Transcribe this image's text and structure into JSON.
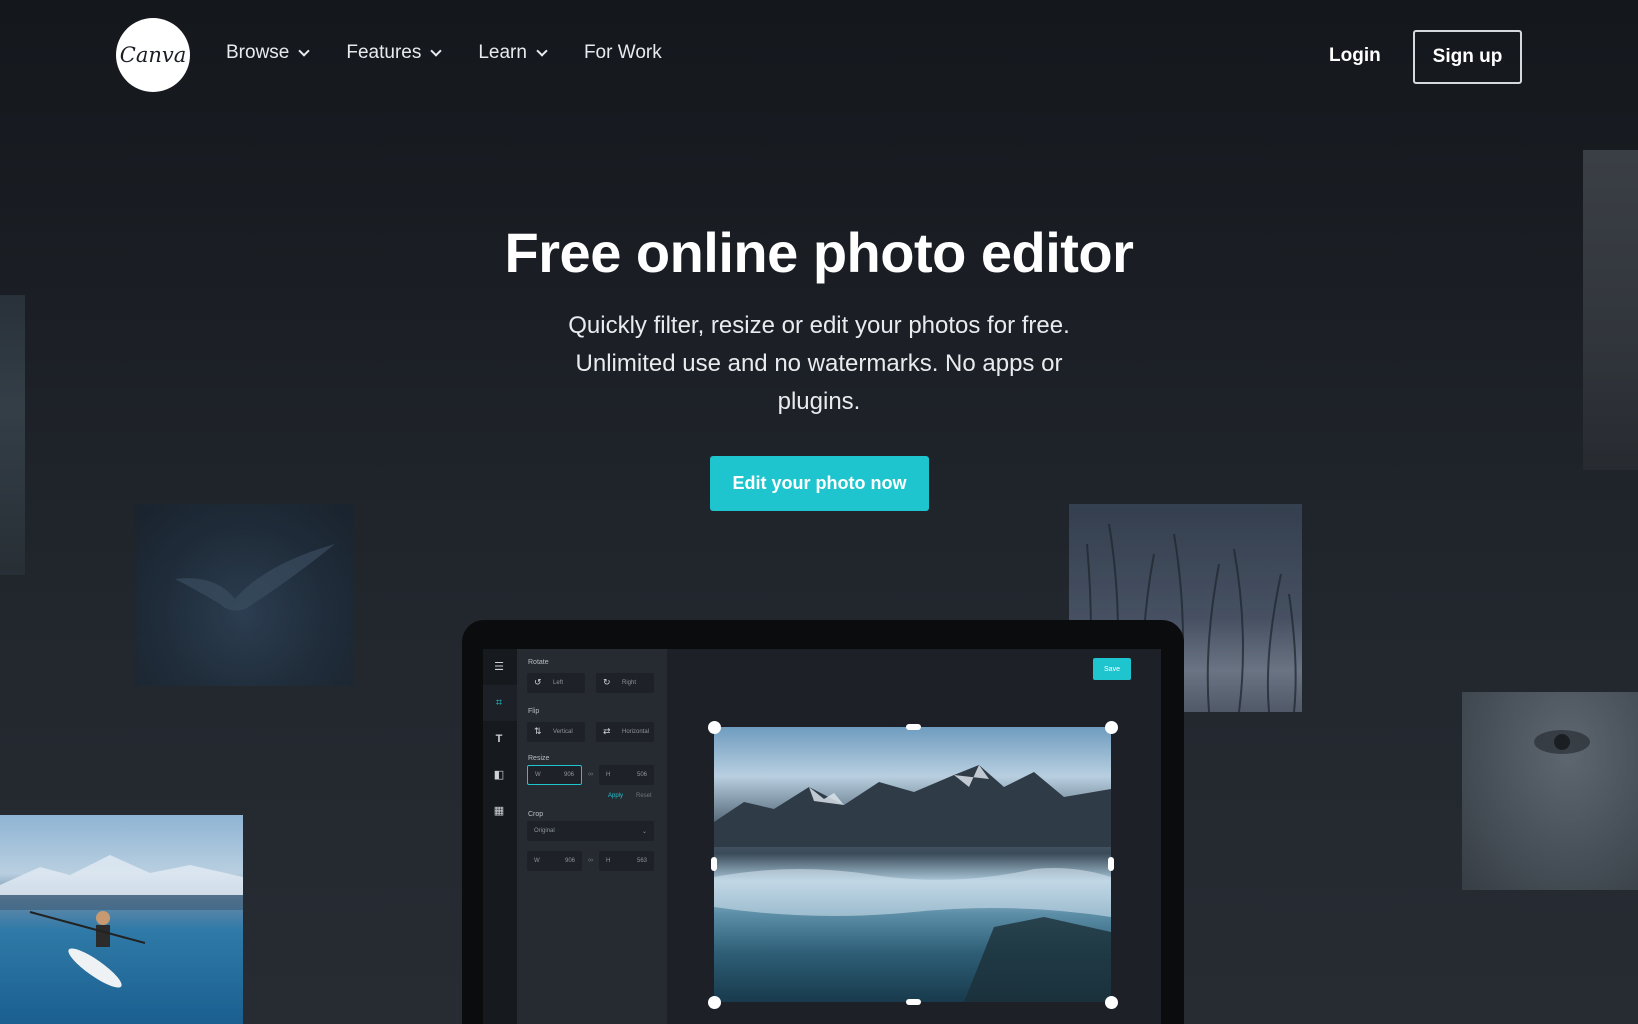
{
  "nav": {
    "logo_text": "Canva",
    "items": [
      {
        "label": "Browse",
        "has_dropdown": true
      },
      {
        "label": "Features",
        "has_dropdown": true
      },
      {
        "label": "Learn",
        "has_dropdown": true
      },
      {
        "label": "For Work",
        "has_dropdown": false
      }
    ],
    "login_label": "Login",
    "signup_label": "Sign up"
  },
  "hero": {
    "title": "Free online photo editor",
    "subtitle_lines": [
      "Quickly filter, resize or edit your photos for free.",
      "Unlimited use and no watermarks. No apps or",
      "plugins."
    ],
    "cta_label": "Edit your photo now"
  },
  "editor": {
    "save_label": "Save",
    "rotate": {
      "label": "Rotate",
      "left": "Left",
      "right": "Right"
    },
    "flip": {
      "label": "Flip",
      "vertical": "Vertical",
      "horizontal": "Horizontal"
    },
    "resize": {
      "label": "Resize",
      "w_prefix": "W",
      "w_value": "906",
      "h_prefix": "H",
      "h_value": "506",
      "apply": "Apply",
      "reset": "Reset"
    },
    "crop": {
      "label": "Crop",
      "preset": "Original",
      "w_prefix": "W",
      "w_value": "906",
      "h_prefix": "H",
      "h_value": "563"
    }
  },
  "colors": {
    "accent": "#1ec5cf",
    "background": "#1b1f25",
    "text": "#ffffff"
  },
  "icons": [
    "chevron-down-icon",
    "adjust-icon",
    "crop-icon",
    "text-icon",
    "frame-icon",
    "grid-icon",
    "rotate-left-icon",
    "rotate-right-icon",
    "flip-vertical-icon",
    "flip-horizontal-icon",
    "link-icon"
  ]
}
